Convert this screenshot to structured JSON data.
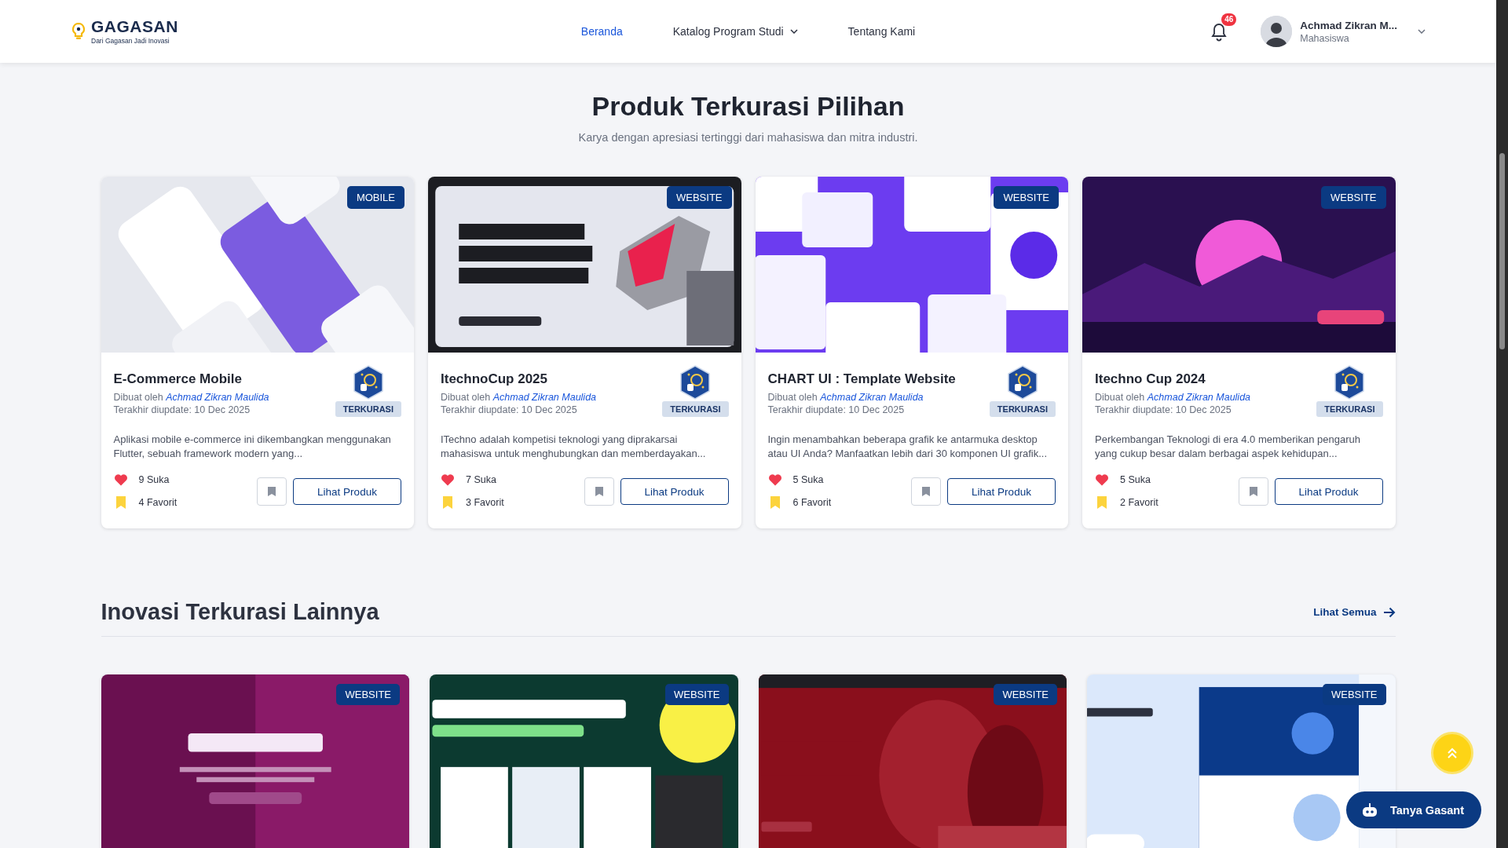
{
  "header": {
    "logo": {
      "name": "GAGASAN",
      "tagline": "Dari Gagasan Jadi Inovasi"
    },
    "nav": [
      {
        "label": "Beranda",
        "selected": true,
        "dropdown": false
      },
      {
        "label": "Katalog Program Studi",
        "selected": false,
        "dropdown": true
      },
      {
        "label": "Tentang Kami",
        "selected": false,
        "dropdown": false
      }
    ],
    "notifications": {
      "count": "46"
    },
    "user": {
      "name": "Achmad Zikran M...",
      "role": "Mahasiswa"
    }
  },
  "featured": {
    "title": "Produk Terkurasi Pilihan",
    "subtitle": "Karya dengan apresiasi tertinggi dari mahasiswa dan mitra industri.",
    "cards": [
      {
        "category": "MOBILE",
        "title": "E-Commerce Mobile",
        "author_prefix": "Dibuat oleh",
        "author": "Achmad Zikran Maulida",
        "updated": "Terakhir diupdate: 10 Dec 2025",
        "badge": "TERKURASI",
        "description": "Aplikasi mobile e-commerce ini dikembangkan menggunakan Flutter, sebuah framework modern yang...",
        "likes": "9 Suka",
        "favorites": "4 Favorit",
        "button": "Lihat Produk"
      },
      {
        "category": "WEBSITE",
        "title": "ItechnoCup 2025",
        "author_prefix": "Dibuat oleh",
        "author": "Achmad Zikran Maulida",
        "updated": "Terakhir diupdate: 10 Dec 2025",
        "badge": "TERKURASI",
        "description": "ITechno adalah kompetisi teknologi yang diprakarsai mahasiswa untuk menghubungkan dan memberdayakan...",
        "likes": "7 Suka",
        "favorites": "3 Favorit",
        "button": "Lihat Produk"
      },
      {
        "category": "WEBSITE",
        "title": "CHART UI : Template Website",
        "author_prefix": "Dibuat oleh",
        "author": "Achmad Zikran Maulida",
        "updated": "Terakhir diupdate: 10 Dec 2025",
        "badge": "TERKURASI",
        "description": "Ingin menambahkan beberapa grafik ke antarmuka desktop atau UI Anda? Manfaatkan lebih dari 30 komponen UI grafik...",
        "likes": "5 Suka",
        "favorites": "6 Favorit",
        "button": "Lihat Produk"
      },
      {
        "category": "WEBSITE",
        "title": "Itechno Cup 2024",
        "author_prefix": "Dibuat oleh",
        "author": "Achmad Zikran Maulida",
        "updated": "Terakhir diupdate: 10 Dec 2025",
        "badge": "TERKURASI",
        "description": "Perkembangan Teknologi di era 4.0 memberikan pengaruh yang cukup besar dalam berbagai aspek kehidupan...",
        "likes": "5 Suka",
        "favorites": "2 Favorit",
        "button": "Lihat Produk"
      }
    ]
  },
  "more": {
    "title": "Inovasi Terkurasi Lainnya",
    "link": "Lihat Semua",
    "cards": [
      {
        "category": "WEBSITE"
      },
      {
        "category": "WEBSITE"
      },
      {
        "category": "WEBSITE"
      },
      {
        "category": "WEBSITE"
      }
    ]
  },
  "chat_button": "Tanya Gasant"
}
